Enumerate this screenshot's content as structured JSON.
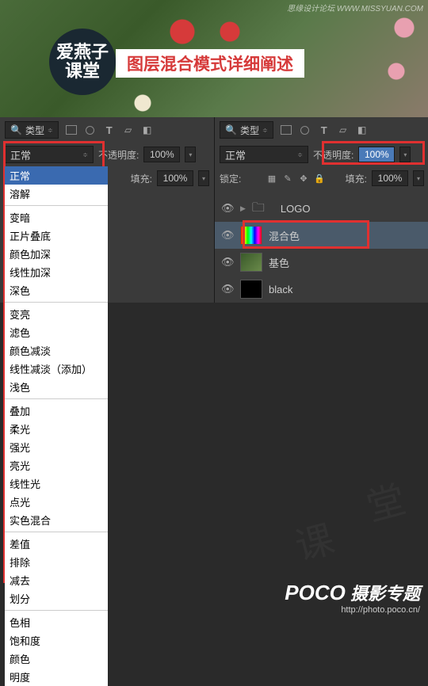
{
  "watermark": "思缘设计论坛  WWW.MISSYUAN.COM",
  "logo_line1": "爱燕子",
  "logo_line2": "课堂",
  "title": "图层混合模式详细阐述",
  "type_label": "类型",
  "search_icon": "🔍",
  "left": {
    "blend_current": "正常",
    "opacity_label": "不透明度:",
    "opacity_value": "100%",
    "fill_label": "填充:",
    "fill_value": "100%"
  },
  "right": {
    "blend_current": "正常",
    "opacity_label": "不透明度:",
    "opacity_value": "100%",
    "lock_label": "锁定:",
    "fill_label": "填充:",
    "fill_value": "100%"
  },
  "blend_modes": {
    "g1": [
      "正常",
      "溶解"
    ],
    "g2": [
      "变暗",
      "正片叠底",
      "颜色加深",
      "线性加深",
      "深色"
    ],
    "g3": [
      "变亮",
      "滤色",
      "颜色减淡",
      "线性减淡（添加）",
      "浅色"
    ],
    "g4": [
      "叠加",
      "柔光",
      "强光",
      "亮光",
      "线性光",
      "点光",
      "实色混合"
    ],
    "g5": [
      "差值",
      "排除",
      "减去",
      "划分"
    ],
    "g6": [
      "色相",
      "饱和度",
      "颜色",
      "明度"
    ]
  },
  "layers": [
    {
      "name": "LOGO",
      "type": "folder"
    },
    {
      "name": "混合色",
      "type": "grad",
      "selected": true
    },
    {
      "name": "基色",
      "type": "photo"
    },
    {
      "name": "black",
      "type": "black"
    }
  ],
  "footer_brand_prefix": "POCO",
  "footer_brand_text": " 摄影专题",
  "footer_url": "http://photo.poco.cn/"
}
